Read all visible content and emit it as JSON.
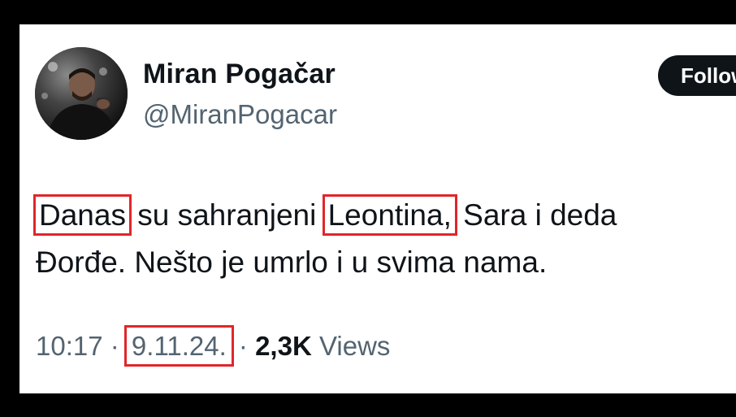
{
  "author": {
    "display_name": "Miran Pogačar",
    "handle": "@MiranPogacar",
    "avatar_icon": "profile-photo"
  },
  "follow_button": {
    "label": "Follow"
  },
  "tweet": {
    "line1": {
      "word1": "Danas",
      "text1": " su sahranjeni ",
      "word2": "Leontina,",
      "text2": " Sara i deda"
    },
    "line2": "Đorđe. Nešto je umrlo i u svima nama."
  },
  "meta": {
    "time": "10:17",
    "separator1": " · ",
    "date": "9.11.24.",
    "separator2": " · ",
    "views_count": "2,3K",
    "views_label": " Views"
  },
  "colors": {
    "background": "#000000",
    "card": "#ffffff",
    "text_primary": "#0f1419",
    "text_secondary": "#536471",
    "highlight_box": "#e0262a",
    "follow_button_bg": "#0f1419"
  }
}
